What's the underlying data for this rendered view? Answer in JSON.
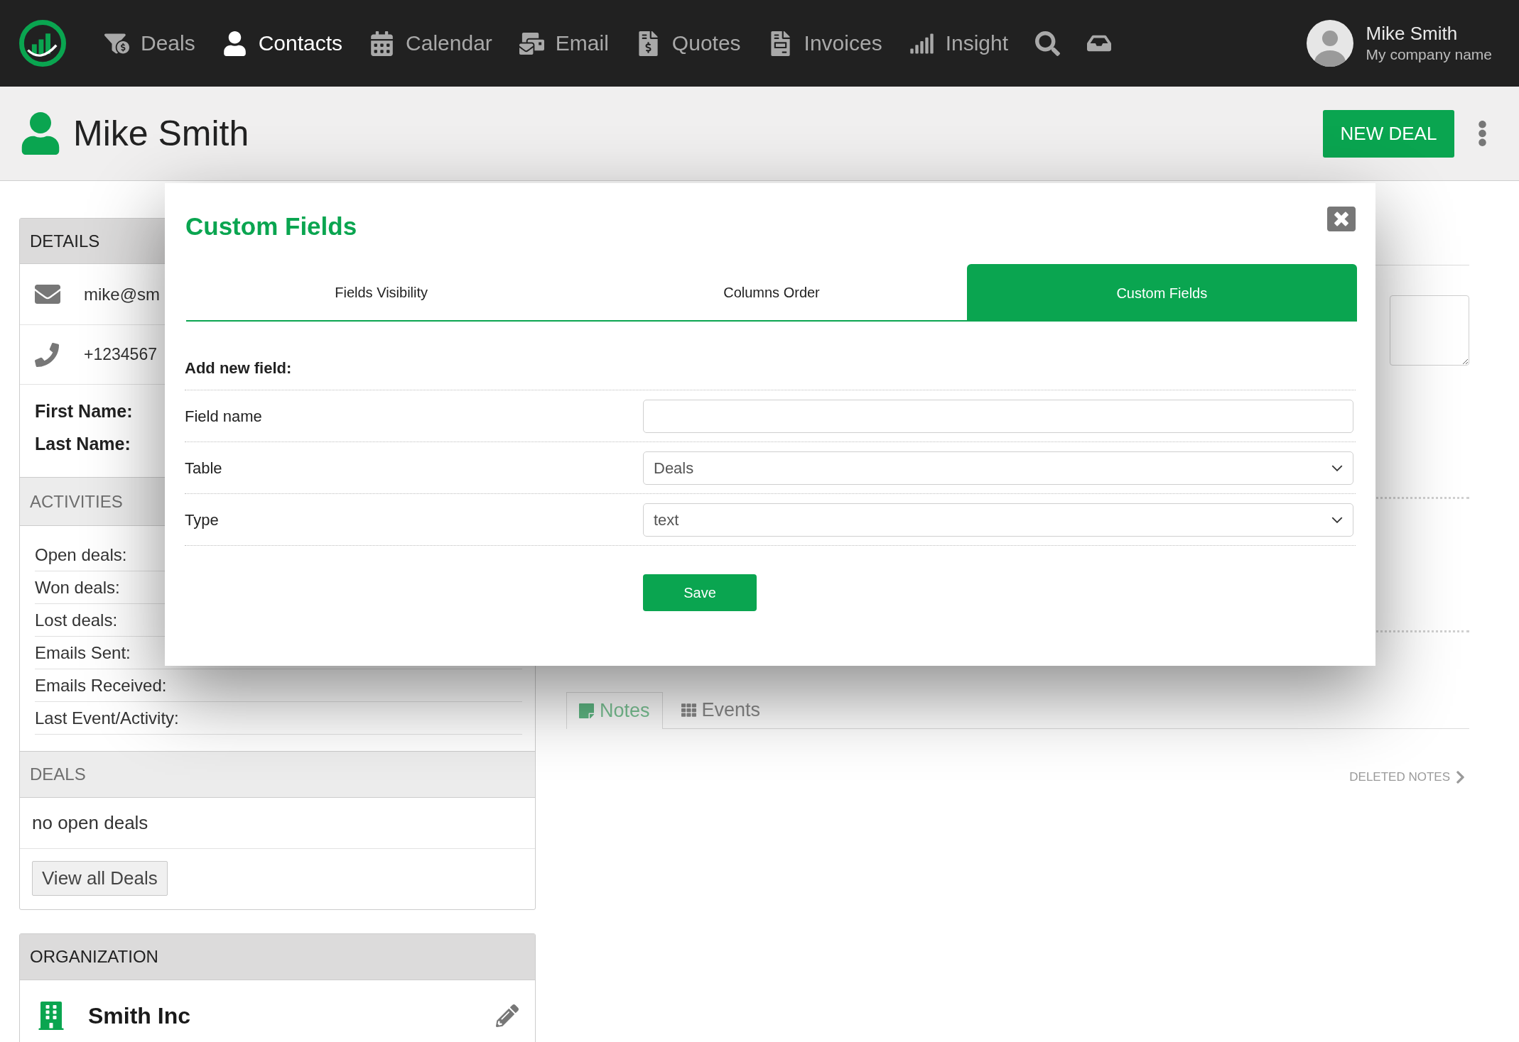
{
  "nav": {
    "items": [
      {
        "label": "Deals",
        "selected": false
      },
      {
        "label": "Contacts",
        "selected": true
      },
      {
        "label": "Calendar",
        "selected": false
      },
      {
        "label": "Email",
        "selected": false
      },
      {
        "label": "Quotes",
        "selected": false
      },
      {
        "label": "Invoices",
        "selected": false
      },
      {
        "label": "Insight",
        "selected": false
      }
    ],
    "user": {
      "name": "Mike Smith",
      "company": "My company name"
    }
  },
  "header": {
    "title": "Mike Smith",
    "button": "NEW DEAL"
  },
  "contact_panel": {
    "details": {
      "title": "DETAILS",
      "muted": false,
      "email": "mike@sm",
      "phone": "+1234567",
      "fields": [
        "First Name:",
        "Last Name:"
      ]
    },
    "activities": {
      "title": "ACTIVITIES",
      "muted": true,
      "rows": [
        "Open deals:",
        "Won deals:",
        "Lost deals:",
        "Emails Sent:",
        "Emails Received:",
        "Last Event/Activity:"
      ]
    },
    "deals": {
      "title": "DEALS",
      "muted": true,
      "empty_text": "no open deals",
      "button": "View all Deals"
    }
  },
  "organization": {
    "title": "ORGANIZATION",
    "muted": false,
    "name": "Smith Inc"
  },
  "notes": {
    "tabs": [
      {
        "label": "Notes",
        "selected": true
      },
      {
        "label": "Events",
        "selected": false
      }
    ],
    "deleted_link": "DELETED NOTES"
  },
  "modal": {
    "title": "Custom Fields",
    "tabs": [
      {
        "label": "Fields Visibility",
        "selected": false
      },
      {
        "label": "Columns Order",
        "selected": false
      },
      {
        "label": "Custom Fields",
        "selected": true
      }
    ],
    "section_title": "Add new field:",
    "fields": [
      {
        "kind": "input",
        "label": "Field name"
      },
      {
        "kind": "select",
        "label": "Table",
        "value": "Deals"
      },
      {
        "kind": "select",
        "label": "Type",
        "value": "text"
      }
    ],
    "save_button": "Save"
  }
}
